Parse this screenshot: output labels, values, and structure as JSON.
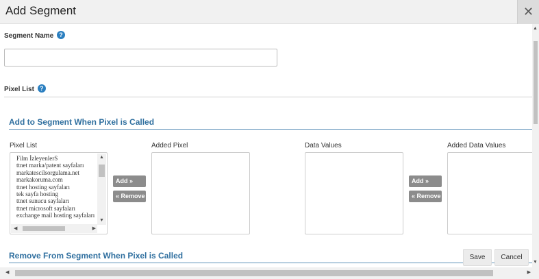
{
  "dialog": {
    "title": "Add Segment",
    "close_glyph": "✕"
  },
  "segment_name": {
    "label": "Segment Name",
    "value": "",
    "help_glyph": "?"
  },
  "pixel_list_section": {
    "label": "Pixel List",
    "help_glyph": "?"
  },
  "add_section": {
    "heading": "Add to Segment When Pixel is Called",
    "pixel_list_label": "Pixel List",
    "added_pixel_label": "Added Pixel",
    "data_values_label": "Data Values",
    "added_data_values_label": "Added Data Values",
    "pixel_items": [
      "Film İzleyenlerS",
      "ttnet marka/patent sayfaları",
      "markatescilsorgulama.net",
      "markakoruma.com",
      "ttnet hosting sayfaları",
      "tek sayfa hosting",
      "ttnet sunucu sayfaları",
      "ttnet microsoft sayfaları",
      "exchange mail hosting sayfaları"
    ],
    "add_button_1": "Add »",
    "remove_button_1": "« Remove",
    "add_button_2": "Add »",
    "remove_button_2": "« Remove"
  },
  "remove_section": {
    "heading": "Remove From Segment When Pixel is Called"
  },
  "footer": {
    "save_label": "Save",
    "cancel_label": "Cancel"
  },
  "icons": {
    "close": "close-icon",
    "help": "help-icon",
    "scroll_up": "arrow-up-icon",
    "scroll_down": "arrow-down-icon",
    "scroll_left": "arrow-left-icon",
    "scroll_right": "arrow-right-icon"
  },
  "colors": {
    "heading": "#2f6f9f",
    "help_icon": "#2b7fc0",
    "button_gray": "#8c8c8c"
  }
}
